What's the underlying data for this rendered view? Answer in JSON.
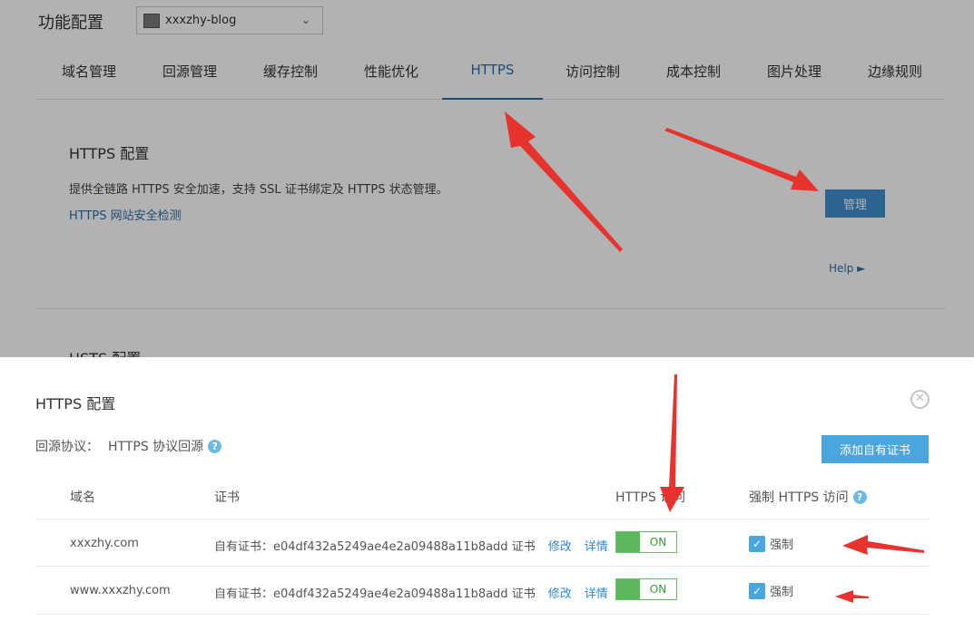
{
  "header": {
    "title": "功能配置",
    "domain_select": "xxxzhy-blog"
  },
  "tabs": [
    {
      "label": "域名管理"
    },
    {
      "label": "回源管理"
    },
    {
      "label": "缓存控制"
    },
    {
      "label": "性能优化"
    },
    {
      "label": "HTTPS"
    },
    {
      "label": "访问控制"
    },
    {
      "label": "成本控制"
    },
    {
      "label": "图片处理"
    },
    {
      "label": "边缘规则"
    }
  ],
  "https_section": {
    "title": "HTTPS 配置",
    "description": "提供全链路 HTTPS 安全加速，支持 SSL 证书绑定及 HTTPS 状态管理。",
    "check_link": "HTTPS 网站安全检测",
    "manage_label": "管理",
    "help_label": "Help ►"
  },
  "hsts_section": {
    "title": "HSTS 配置"
  },
  "dialog": {
    "title": "HTTPS 配置",
    "origin_label": "回源协议：",
    "origin_value": "HTTPS 协议回源",
    "add_cert_label": "添加自有证书",
    "columns": {
      "domain": "域名",
      "cert": "证书",
      "https_access": "HTTPS 访问",
      "force_https": "强制 HTTPS 访问"
    },
    "rows": [
      {
        "domain": "xxxzhy.com",
        "cert": "自有证书：e04df432a5249ae4e2a09488a11b8add 证书",
        "edit": "修改",
        "detail": "详情",
        "toggle": "ON",
        "force": "强制"
      },
      {
        "domain": "www.xxxzhy.com",
        "cert": "自有证书：e04df432a5249ae4e2a09488a11b8add 证书",
        "edit": "修改",
        "detail": "详情",
        "toggle": "ON",
        "force": "强制"
      }
    ]
  },
  "colors": {
    "accent": "#2e6fa8",
    "button_blue": "#4aa6dc",
    "toggle_green": "#5cb85c",
    "annotation_red": "#e8322e"
  }
}
